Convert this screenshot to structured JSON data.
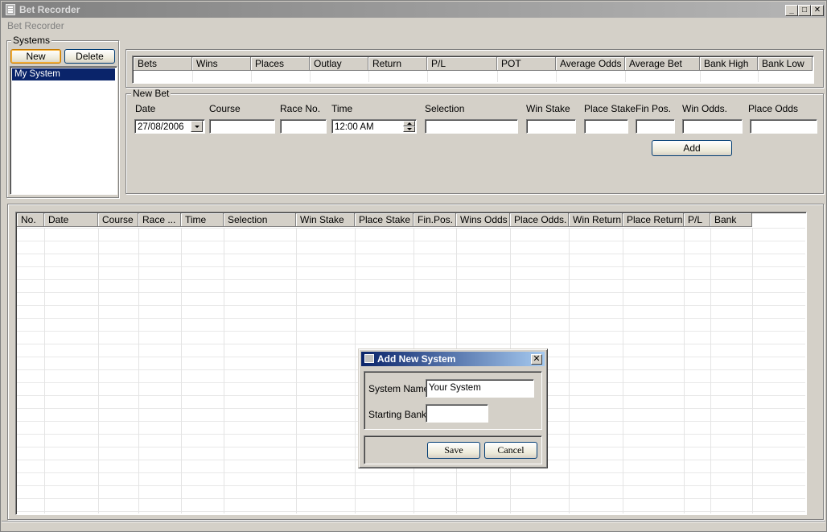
{
  "window": {
    "title": "Bet Recorder",
    "minimize_glyph": "_",
    "maximize_glyph": "□",
    "close_glyph": "✕"
  },
  "menu": {
    "bet_recorder": "Bet Recorder"
  },
  "systems": {
    "legend": "Systems",
    "new_label": "New",
    "delete_label": "Delete",
    "items": [
      "My System"
    ]
  },
  "summary": {
    "columns": [
      "Bets",
      "Wins",
      "Places",
      "Outlay",
      "Return",
      "P/L",
      "POT",
      "Average Odds",
      "Average Bet",
      "Bank High",
      "Bank Low"
    ]
  },
  "new_bet": {
    "legend": "New Bet",
    "labels": {
      "date": "Date",
      "course": "Course",
      "race_no": "Race No.",
      "time": "Time",
      "selection": "Selection",
      "win_stake": "Win Stake",
      "place_stake": "Place Stake",
      "fin_pos": "Fin Pos.",
      "win_odds": "Win Odds.",
      "place_odds": "Place Odds"
    },
    "values": {
      "date": "27/08/2006",
      "course": "",
      "race_no": "",
      "time": "12:00 AM",
      "selection": "",
      "win_stake": "",
      "place_stake": "",
      "fin_pos": "",
      "win_odds": "",
      "place_odds": ""
    },
    "add_label": "Add"
  },
  "bets_grid": {
    "columns": [
      "No.",
      "Date",
      "Course",
      "Race ...",
      "Time",
      "Selection",
      "Win Stake",
      "Place Stake",
      "Fin.Pos.",
      "Wins Odds",
      "Place Odds.",
      "Win Return",
      "Place Return",
      "P/L",
      "Bank"
    ]
  },
  "dialog": {
    "title": "Add New System",
    "system_name_label": "System Name",
    "system_name_value": "Your System",
    "starting_bank_label": "Starting Bank",
    "starting_bank_value": "",
    "save_label": "Save",
    "cancel_label": "Cancel",
    "close_glyph": "✕"
  }
}
